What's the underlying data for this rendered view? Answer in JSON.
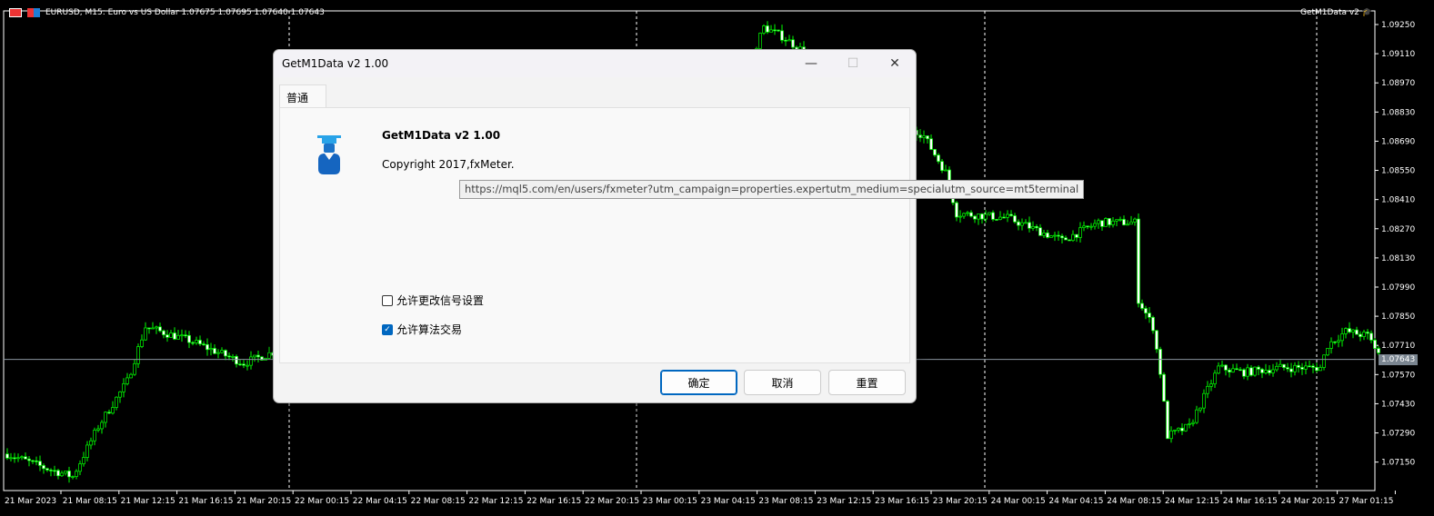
{
  "chart": {
    "symbol_header": "EURUSD, M15:  Euro vs US Dollar  1.07675 1.07695 1.07640 1.07643",
    "indicator_label": "GetM1Data v2",
    "current_price": "1.07643",
    "price_ticks": [
      "1.09250",
      "1.09110",
      "1.08970",
      "1.08830",
      "1.08690",
      "1.08550",
      "1.08410",
      "1.08270",
      "1.08130",
      "1.07990",
      "1.07850",
      "1.07710",
      "1.07570",
      "1.07430",
      "1.07290",
      "1.07150"
    ],
    "time_ticks": [
      "21 Mar 2023",
      "21 Mar 08:15",
      "21 Mar 12:15",
      "21 Mar 16:15",
      "21 Mar 20:15",
      "22 Mar 00:15",
      "22 Mar 04:15",
      "22 Mar 08:15",
      "22 Mar 12:15",
      "22 Mar 16:15",
      "22 Mar 20:15",
      "23 Mar 00:15",
      "23 Mar 04:15",
      "23 Mar 08:15",
      "23 Mar 12:15",
      "23 Mar 16:15",
      "23 Mar 20:15",
      "24 Mar 00:15",
      "24 Mar 04:15",
      "24 Mar 08:15",
      "24 Mar 12:15",
      "24 Mar 16:15",
      "24 Mar 20:15",
      "27 Mar 01:15"
    ],
    "price_path": [
      [
        0,
        1.07189
      ],
      [
        10,
        1.07124
      ],
      [
        18,
        1.0708
      ],
      [
        25,
        1.0732
      ],
      [
        33,
        1.07538
      ],
      [
        38,
        1.07799
      ],
      [
        50,
        1.07734
      ],
      [
        65,
        1.07625
      ],
      [
        75,
        1.0769
      ],
      [
        125,
        1.08
      ],
      [
        175,
        1.0822
      ],
      [
        200,
        1.089
      ],
      [
        208,
        1.09237
      ],
      [
        213,
        1.09193
      ],
      [
        252,
        1.08714
      ],
      [
        258,
        1.0854
      ],
      [
        261,
        1.08344
      ],
      [
        275,
        1.08322
      ],
      [
        290,
        1.08213
      ],
      [
        300,
        1.083
      ],
      [
        310,
        1.083
      ],
      [
        311,
        1.0793
      ],
      [
        315,
        1.07799
      ],
      [
        317,
        1.07581
      ],
      [
        319,
        1.07276
      ],
      [
        325,
        1.0732
      ],
      [
        333,
        1.07603
      ],
      [
        340,
        1.07581
      ],
      [
        350,
        1.07603
      ],
      [
        361,
        1.07603
      ],
      [
        363,
        1.07712
      ],
      [
        368,
        1.07777
      ],
      [
        374,
        1.07756
      ],
      [
        378,
        1.07647
      ]
    ],
    "bull_color": "#00ff00"
  },
  "dialog": {
    "title": "GetM1Data v2 1.00",
    "tab": "普通",
    "name": "GetM1Data v2 1.00",
    "copyright": "Copyright 2017,fxMeter.",
    "tooltip": "https://mql5.com/en/users/fxmeter?utm_campaign=properties.expertutm_medium=specialutm_source=mt5terminal",
    "checkbox_signal": "允许更改信号设置",
    "checkbox_algo": "允许算法交易",
    "ok": "确定",
    "cancel": "取消",
    "reset": "重置"
  }
}
